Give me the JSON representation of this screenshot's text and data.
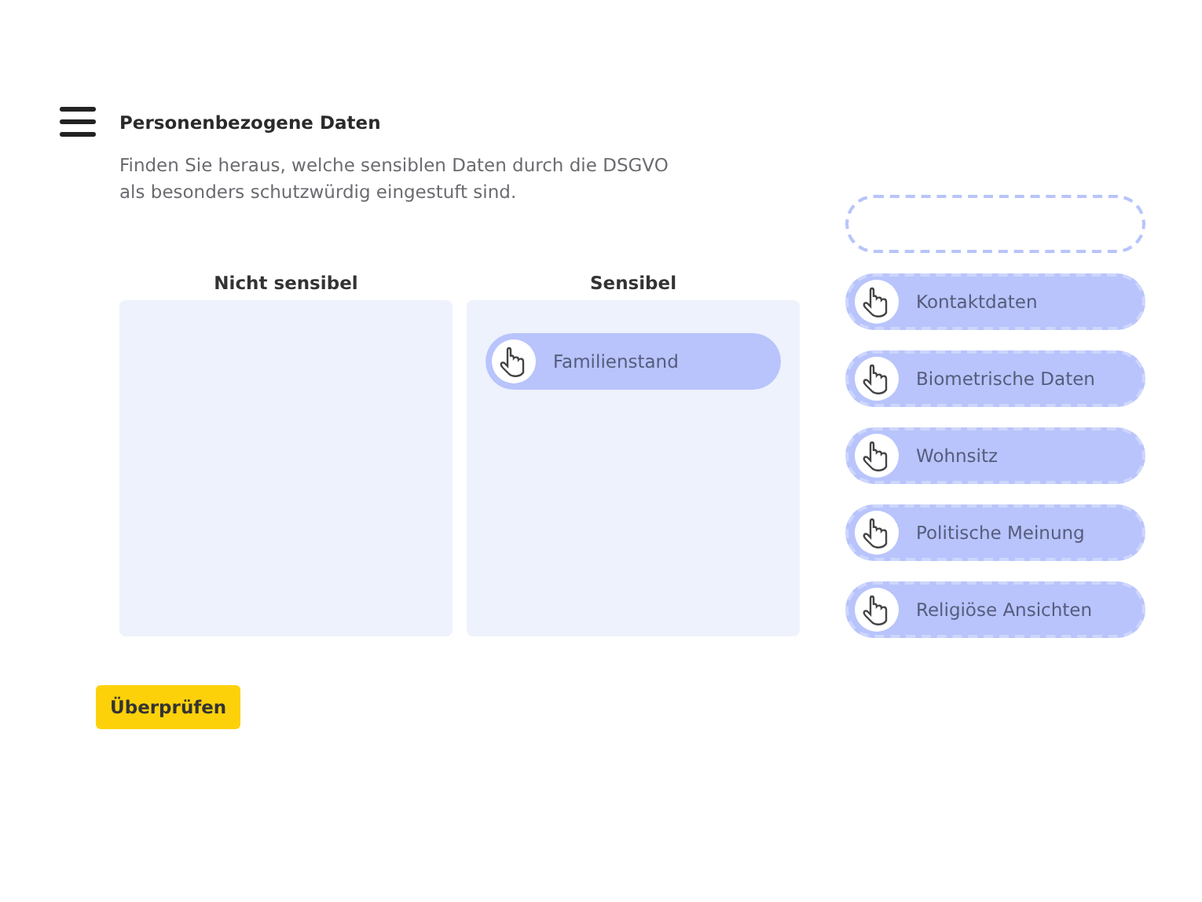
{
  "header": {
    "title": "Personenbezogene Daten"
  },
  "description": "Finden Sie heraus, welche sensiblen Daten durch die DSGVO als besonders schutzwürdig eingestuft sind.",
  "zones": [
    {
      "heading": "Nicht sensibel"
    },
    {
      "heading": "Sensibel",
      "items": [
        "Familienstand"
      ]
    }
  ],
  "pool": [
    {
      "kind": "slot"
    },
    {
      "kind": "chip",
      "label": "Kontaktdaten"
    },
    {
      "kind": "chip",
      "label": "Biometrische Daten"
    },
    {
      "kind": "chip",
      "label": "Wohnsitz"
    },
    {
      "kind": "chip",
      "label": "Politische Meinung"
    },
    {
      "kind": "chip",
      "label": "Religiöse Ansichten"
    }
  ],
  "check_button": "Überprüfen"
}
